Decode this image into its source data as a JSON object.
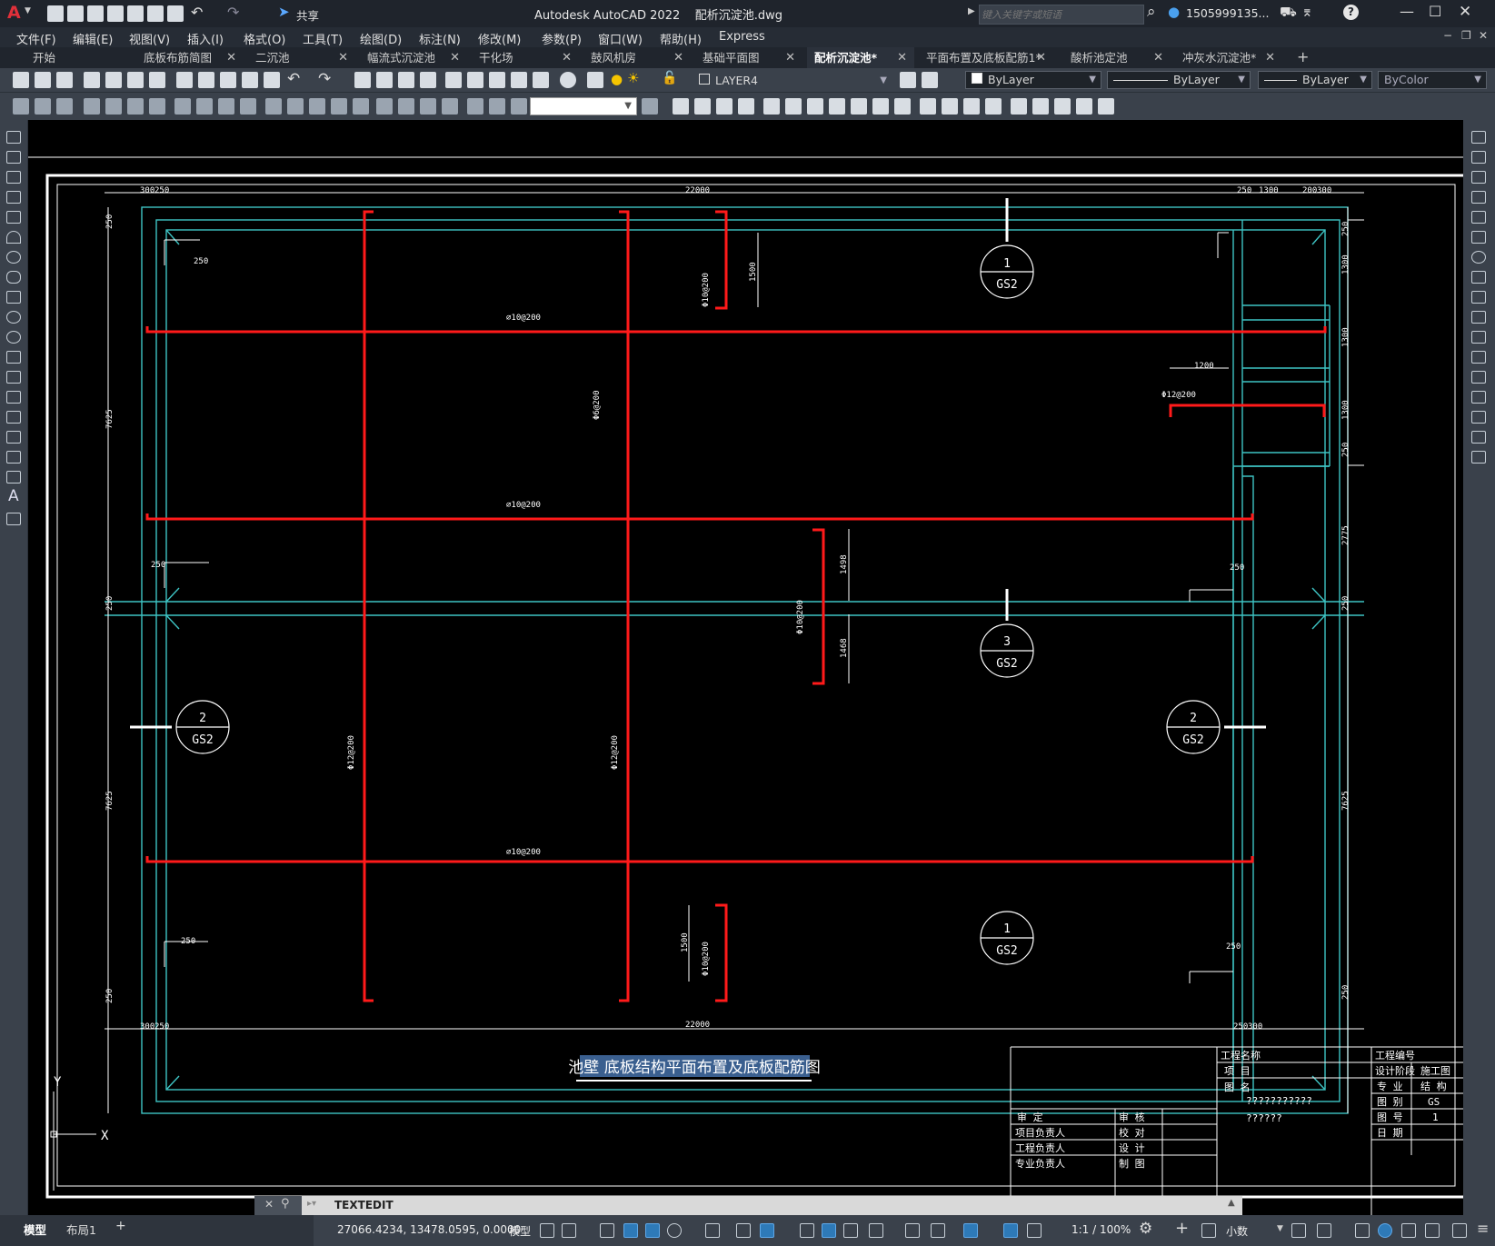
{
  "app": {
    "logo_letter": "A",
    "title": "Autodesk AutoCAD 2022",
    "filename": "配析沉淀池.dwg",
    "share_label": "共享",
    "search_placeholder": "键入关键字或短语",
    "user": "1505999135...",
    "help": "?"
  },
  "menu": [
    "文件(F)",
    "编辑(E)",
    "视图(V)",
    "插入(I)",
    "格式(O)",
    "工具(T)",
    "绘图(D)",
    "标注(N)",
    "修改(M)",
    "参数(P)",
    "窗口(W)",
    "帮助(H)",
    "Express"
  ],
  "tabs": [
    {
      "label": "开始",
      "active": false
    },
    {
      "label": "底板布筋简图",
      "active": false
    },
    {
      "label": "二沉池",
      "active": false
    },
    {
      "label": "幅流式沉淀池",
      "active": false
    },
    {
      "label": "干化场",
      "active": false
    },
    {
      "label": "鼓风机房",
      "active": false
    },
    {
      "label": "基础平面图",
      "active": false
    },
    {
      "label": "配析沉淀池*",
      "active": true
    },
    {
      "label": "平面布置及底板配筋1*",
      "active": false
    },
    {
      "label": "酸析池定池",
      "active": false
    },
    {
      "label": "冲灰水沉淀池*",
      "active": false
    }
  ],
  "toolbar": {
    "layer": "LAYER4",
    "color": "ByLayer",
    "linetype": "ByLayer",
    "lineweight": "ByLayer",
    "plotstyle": "ByColor"
  },
  "drawing": {
    "dims": {
      "top_total": "22000",
      "bottom_total": "22000",
      "d300": "300",
      "d250": "250",
      "d200": "200",
      "d1300": "1300",
      "d1200": "1200",
      "d2775": "2775",
      "d7625": "7625",
      "d1500": "1500",
      "d1498": "1498",
      "d1468": "1468"
    },
    "rebar": {
      "phi10_200": "⌀10@200",
      "phi10_200b": "Φ10@200",
      "phi12_200": "Φ12@200",
      "phi6_200": "Φ6@200"
    },
    "sections": {
      "s1": "1",
      "s2": "2",
      "s3": "3",
      "ref": "GS2"
    },
    "title": "池壁 底板结构平面布置及底板配筋图",
    "axis_y": "Y",
    "title_block": {
      "project_name": "工程名称",
      "project_no": "工程编号",
      "item": "项   目",
      "design_stage": "设计阶段",
      "stage_value": "施工图",
      "drawing_name": "图  名",
      "name_value1": "???????????",
      "name_value2": "??????",
      "specialty": "专  业",
      "specialty_value": "结  构",
      "category": "图  别",
      "category_value": "GS",
      "sheet_no": "图  号",
      "sheet_value": "1",
      "date": "日  期",
      "approve": "审    定",
      "review": "审    核",
      "proj_lead": "项目负责人",
      "check": "校    对",
      "eng_lead": "工程负责人",
      "design": "设    计",
      "spec_lead": "专业负责人",
      "draw": "制    图"
    }
  },
  "command": {
    "text": "TEXTEDIT"
  },
  "layout_tabs": [
    "模型",
    "布局1"
  ],
  "status": {
    "coords": "27066.4234, 13478.0595, 0.0000",
    "mode": "模型",
    "scale": "1:1 / 100%",
    "units": "小数"
  }
}
